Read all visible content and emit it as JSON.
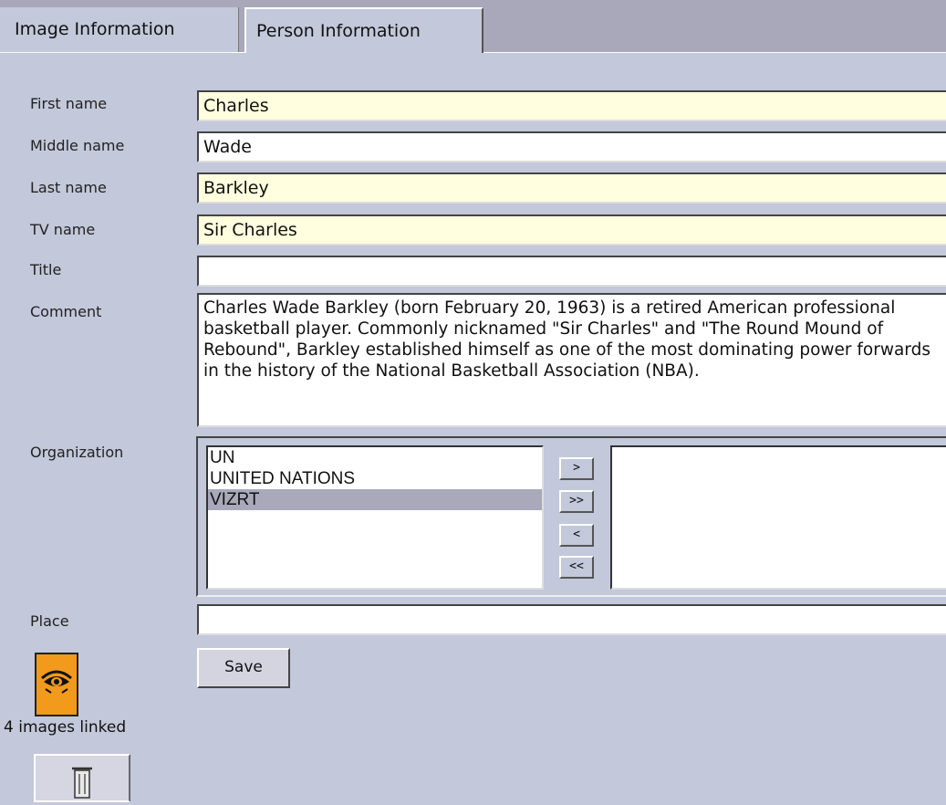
{
  "tabs": [
    {
      "label": "Image Information"
    },
    {
      "label": "Person Information"
    }
  ],
  "form": {
    "first_name": {
      "label": "First name",
      "value": "Charles"
    },
    "middle_name": {
      "label": "Middle name",
      "value": "Wade"
    },
    "last_name": {
      "label": "Last name",
      "value": "Barkley"
    },
    "tv_name": {
      "label": "TV name",
      "value": "Sir Charles"
    },
    "title": {
      "label": "Title",
      "value": ""
    },
    "comment": {
      "label": "Comment",
      "value": "Charles Wade Barkley (born February 20, 1963) is a retired American professional basketball player. Commonly nicknamed \"Sir Charles\" and \"The Round Mound of Rebound\", Barkley established himself as one of the most dominating power forwards in the history of the National Basketball Association (NBA)."
    },
    "organization": {
      "label": "Organization",
      "available": [
        "UN",
        "UNITED NATIONS",
        "VIZRT"
      ],
      "selected_highlight": "VIZRT",
      "assigned": [],
      "buttons": {
        "add": ">",
        "add_all": ">>",
        "remove": "<",
        "remove_all": "<<"
      }
    },
    "place": {
      "label": "Place",
      "value": ""
    },
    "save_label": "Save"
  },
  "linked": {
    "icon": "eye-icon",
    "text": "4 images linked"
  },
  "delete": {
    "icon": "trash-icon"
  },
  "colors": {
    "background": "#c3c8da",
    "required_field": "#ffffdf",
    "link_icon": "#f29a1b",
    "selected_option": "#a9a9bb"
  }
}
